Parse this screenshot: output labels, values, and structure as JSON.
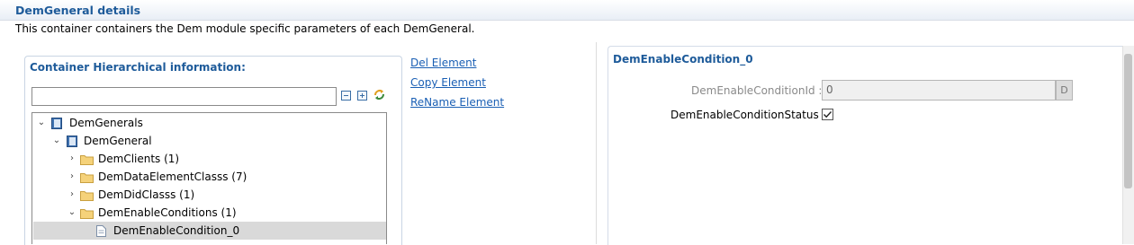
{
  "header": {
    "title": "DemGeneral details"
  },
  "description": "This container containers the Dem module specific parameters of each DemGeneral.",
  "hierarchy": {
    "title": "Container Hierarchical information:",
    "filter_value": "",
    "toolbar": [
      "collapse-all-icon",
      "expand-all-icon",
      "link-sync-icon"
    ],
    "tree": [
      {
        "label": "DemGenerals",
        "level": 0,
        "expanded": true,
        "icon": "container-icon"
      },
      {
        "label": "DemGeneral",
        "level": 1,
        "expanded": true,
        "icon": "container-icon"
      },
      {
        "label": "DemClients (1)",
        "level": 2,
        "expanded": false,
        "icon": "folder-icon"
      },
      {
        "label": "DemDataElementClasss (7)",
        "level": 2,
        "expanded": false,
        "icon": "folder-icon"
      },
      {
        "label": "DemDidClasss (1)",
        "level": 2,
        "expanded": false,
        "icon": "folder-icon"
      },
      {
        "label": "DemEnableConditions (1)",
        "level": 2,
        "expanded": true,
        "icon": "folder-icon"
      },
      {
        "label": "DemEnableCondition_0",
        "level": 3,
        "selected": true,
        "icon": "document-icon"
      }
    ]
  },
  "actions": {
    "del": "Del Element",
    "copy": "Copy Element",
    "rename": "ReName Element"
  },
  "details": {
    "title": "DemEnableCondition_0",
    "id_label": "DemEnableConditionId :",
    "id_value": "0",
    "id_button": "D",
    "status_label": "DemEnableConditionStatus :",
    "status_checked": true
  },
  "colors": {
    "accent": "#1e5b9a",
    "link": "#1a5fb4",
    "selection": "#d9d9d9"
  }
}
